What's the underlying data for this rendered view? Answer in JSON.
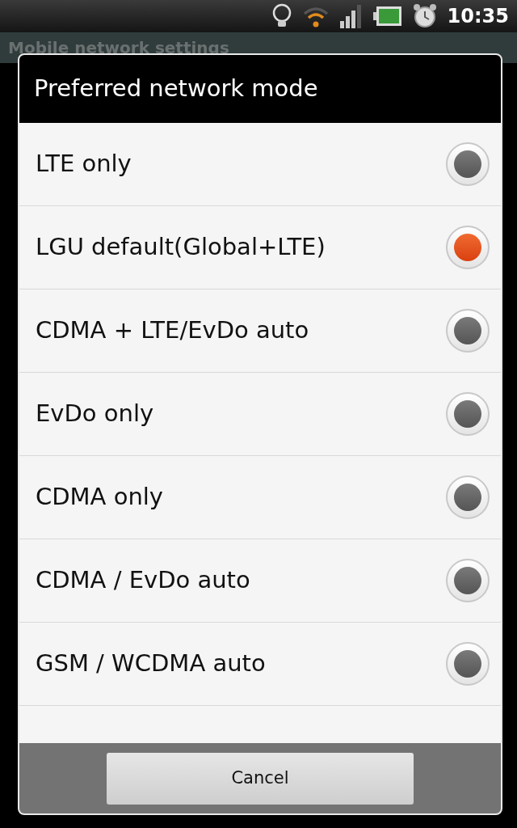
{
  "status_bar": {
    "time": "10:35"
  },
  "screen_title": "Mobile network settings",
  "dialog": {
    "title": "Preferred network mode",
    "options": [
      {
        "label": "LTE only",
        "selected": false
      },
      {
        "label": "LGU default(Global+LTE)",
        "selected": true
      },
      {
        "label": "CDMA + LTE/EvDo auto",
        "selected": false
      },
      {
        "label": "EvDo only",
        "selected": false
      },
      {
        "label": "CDMA only",
        "selected": false
      },
      {
        "label": "CDMA / EvDo auto",
        "selected": false
      },
      {
        "label": "GSM / WCDMA auto",
        "selected": false
      }
    ],
    "buttons": [
      "Cancel"
    ]
  }
}
